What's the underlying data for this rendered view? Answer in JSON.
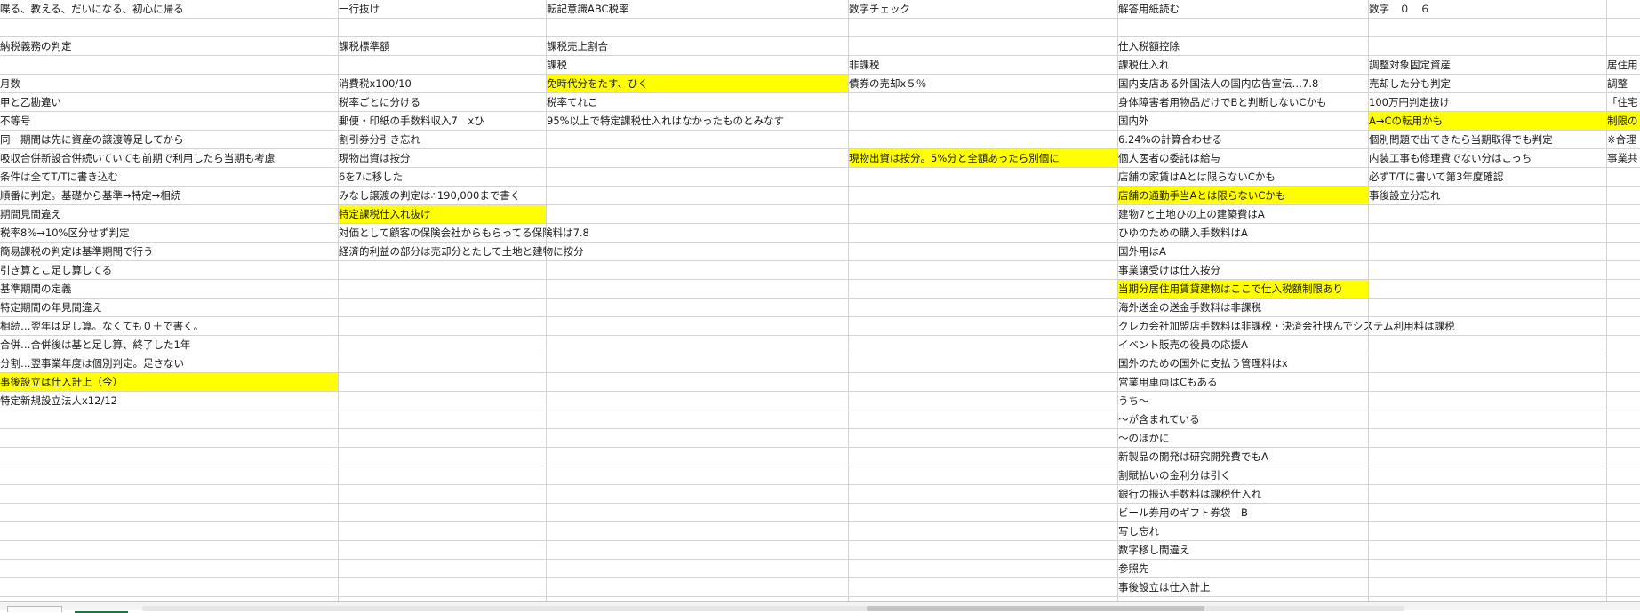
{
  "rows": [
    {
      "cells": [
        {
          "col": 0,
          "text": "喋る、教える、だいになる、初心に帰る"
        },
        {
          "col": 1,
          "text": "一行抜け"
        },
        {
          "col": 2,
          "text": "転記意識ABC税率"
        },
        {
          "col": 3,
          "text": "数字チェック"
        },
        {
          "col": 4,
          "text": "解答用紙読む"
        },
        {
          "col": 5,
          "text": "数字　０　６"
        }
      ]
    },
    {
      "cells": []
    },
    {
      "cells": [
        {
          "col": 0,
          "text": "納税義務の判定"
        },
        {
          "col": 1,
          "text": "課税標準額"
        },
        {
          "col": 2,
          "text": "課税売上割合"
        },
        {
          "col": 4,
          "text": "仕入税額控除"
        }
      ]
    },
    {
      "cells": [
        {
          "col": 2,
          "text": "課税"
        },
        {
          "col": 3,
          "text": "非課税"
        },
        {
          "col": 4,
          "text": "課税仕入れ"
        },
        {
          "col": 5,
          "text": "調整対象固定資産"
        },
        {
          "col": 6,
          "text": "居住用"
        }
      ]
    },
    {
      "cells": [
        {
          "col": 0,
          "text": "月数"
        },
        {
          "col": 1,
          "text": "消費税ⅹ100/10"
        },
        {
          "col": 2,
          "text": "免時代分をたす、ひく",
          "hl": true
        },
        {
          "col": 3,
          "text": "債券の売却ⅹ５％"
        },
        {
          "col": 4,
          "text": "国内支店ある外国法人の国内広告宣伝…7.8"
        },
        {
          "col": 5,
          "text": "売却した分も判定"
        },
        {
          "col": 6,
          "text": "調整"
        }
      ]
    },
    {
      "cells": [
        {
          "col": 0,
          "text": "甲と乙勘違い"
        },
        {
          "col": 1,
          "text": "税率ごとに分ける"
        },
        {
          "col": 2,
          "text": "税率てれこ"
        },
        {
          "col": 4,
          "text": "身体障害者用物品だけでBと判断しないCかも"
        },
        {
          "col": 5,
          "text": "100万円判定抜け"
        },
        {
          "col": 6,
          "text": "「住宅"
        }
      ]
    },
    {
      "cells": [
        {
          "col": 0,
          "text": "不等号"
        },
        {
          "col": 1,
          "text": "郵便・印紙の手数料収入7　ⅹひ"
        },
        {
          "col": 2,
          "text": "95%以上で特定課税仕入れはなかったものとみなす"
        },
        {
          "col": 4,
          "text": "国内外"
        },
        {
          "col": 5,
          "text": "A→Cの転用かも",
          "hl": true
        },
        {
          "col": 6,
          "text": "制限の",
          "hl": true
        }
      ]
    },
    {
      "cells": [
        {
          "col": 0,
          "text": "同一期間は先に資産の譲渡等足してから"
        },
        {
          "col": 1,
          "text": "割引券分引き忘れ"
        },
        {
          "col": 4,
          "text": "6.24%の計算合わせる"
        },
        {
          "col": 5,
          "text": "個別問題で出てきたら当期取得でも判定"
        },
        {
          "col": 6,
          "text": "※合理"
        }
      ]
    },
    {
      "cells": [
        {
          "col": 0,
          "text": "吸収合併新設合併続いていても前期で利用したら当期も考慮"
        },
        {
          "col": 1,
          "text": "現物出資は按分"
        },
        {
          "col": 3,
          "text": "現物出資は按分。5%分と全額あったら別個に",
          "hl": true
        },
        {
          "col": 4,
          "text": "個人医者の委託は給与"
        },
        {
          "col": 5,
          "text": "内装工事も修理費でない分はこっち"
        },
        {
          "col": 6,
          "text": "事業共"
        }
      ]
    },
    {
      "cells": [
        {
          "col": 0,
          "text": "条件は全てT/Tに書き込む"
        },
        {
          "col": 1,
          "text": "6を7に移した"
        },
        {
          "col": 4,
          "text": "店舗の家賃はAとは限らないCかも"
        },
        {
          "col": 5,
          "text": "必ずT/Tに書いて第3年度確認"
        }
      ]
    },
    {
      "cells": [
        {
          "col": 0,
          "text": "順番に判定。基礎から基準→特定→相続"
        },
        {
          "col": 1,
          "text": "みなし譲渡の判定は∴190,000まで書く"
        },
        {
          "col": 4,
          "text": "店舗の通勤手当Aとは限らないCかも",
          "hl": true
        },
        {
          "col": 5,
          "text": "事後設立分忘れ"
        }
      ]
    },
    {
      "cells": [
        {
          "col": 0,
          "text": "期間見間違え"
        },
        {
          "col": 1,
          "text": "特定課税仕入れ抜け",
          "hl": true
        },
        {
          "col": 4,
          "text": "建物7と土地ひの上の建築費はA"
        }
      ]
    },
    {
      "cells": [
        {
          "col": 0,
          "text": "税率8%→10%区分せず判定"
        },
        {
          "col": 1,
          "text": "対価として顧客の保険会社からもらってる保険料は7.8"
        },
        {
          "col": 4,
          "text": "ひゆのための購入手数料はA"
        }
      ]
    },
    {
      "cells": [
        {
          "col": 0,
          "text": "簡易課税の判定は基準期間で行う"
        },
        {
          "col": 1,
          "text": "経済的利益の部分は売却分とたして土地と建物に按分"
        },
        {
          "col": 4,
          "text": "国外用はA"
        }
      ]
    },
    {
      "cells": [
        {
          "col": 0,
          "text": "引き算とこ足し算してる"
        },
        {
          "col": 4,
          "text": "事業譲受けは仕入按分"
        }
      ]
    },
    {
      "cells": [
        {
          "col": 0,
          "text": "基準期間の定義"
        },
        {
          "col": 4,
          "text": "当期分居住用賃貸建物はここで仕入税額制限あり",
          "hl": true
        }
      ]
    },
    {
      "cells": [
        {
          "col": 0,
          "text": "特定期間の年見間違え"
        },
        {
          "col": 4,
          "text": "海外送金の送金手数料は非課税"
        }
      ]
    },
    {
      "cells": [
        {
          "col": 0,
          "text": "相続…翌年は足し算。なくても０＋で書く。"
        },
        {
          "col": 4,
          "text": "クレカ会社加盟店手数料は非課税・決済会社挟んでシステム利用料は課税"
        }
      ]
    },
    {
      "cells": [
        {
          "col": 0,
          "text": "合併…合併後は基と足し算、終了した1年"
        },
        {
          "col": 4,
          "text": "イベント販売の役員の応援A"
        }
      ]
    },
    {
      "cells": [
        {
          "col": 0,
          "text": "分割…翌事業年度は個別判定。足さない"
        },
        {
          "col": 4,
          "text": "国外のための国外に支払う管理料はⅹ"
        }
      ]
    },
    {
      "cells": [
        {
          "col": 0,
          "text": "事後設立は仕入計上（今）",
          "hl": true
        },
        {
          "col": 4,
          "text": "営業用車両はCもある"
        }
      ]
    },
    {
      "cells": [
        {
          "col": 0,
          "text": "特定新規設立法人ⅹ12/12"
        },
        {
          "col": 4,
          "text": "うち～"
        }
      ]
    },
    {
      "cells": [
        {
          "col": 4,
          "text": "～が含まれている"
        }
      ]
    },
    {
      "cells": [
        {
          "col": 4,
          "text": "～のほかに"
        }
      ]
    },
    {
      "cells": [
        {
          "col": 4,
          "text": "新製品の開発は研究開発費でもA"
        }
      ]
    },
    {
      "cells": [
        {
          "col": 4,
          "text": "割賦払いの金利分は引く"
        }
      ]
    },
    {
      "cells": [
        {
          "col": 4,
          "text": "銀行の振込手数料は課税仕入れ"
        }
      ]
    },
    {
      "cells": [
        {
          "col": 4,
          "text": "ビール券用のギフト券袋　B"
        }
      ]
    },
    {
      "cells": [
        {
          "col": 4,
          "text": "写し忘れ"
        }
      ]
    },
    {
      "cells": [
        {
          "col": 4,
          "text": "数字移し間違え"
        }
      ]
    },
    {
      "cells": [
        {
          "col": 4,
          "text": "参照先"
        }
      ]
    },
    {
      "cells": [
        {
          "col": 4,
          "text": "事後設立は仕入計上"
        }
      ]
    },
    {
      "cells": []
    }
  ],
  "status": {
    "highlight_color": "#ffff00",
    "sheet_tab_label": ""
  }
}
